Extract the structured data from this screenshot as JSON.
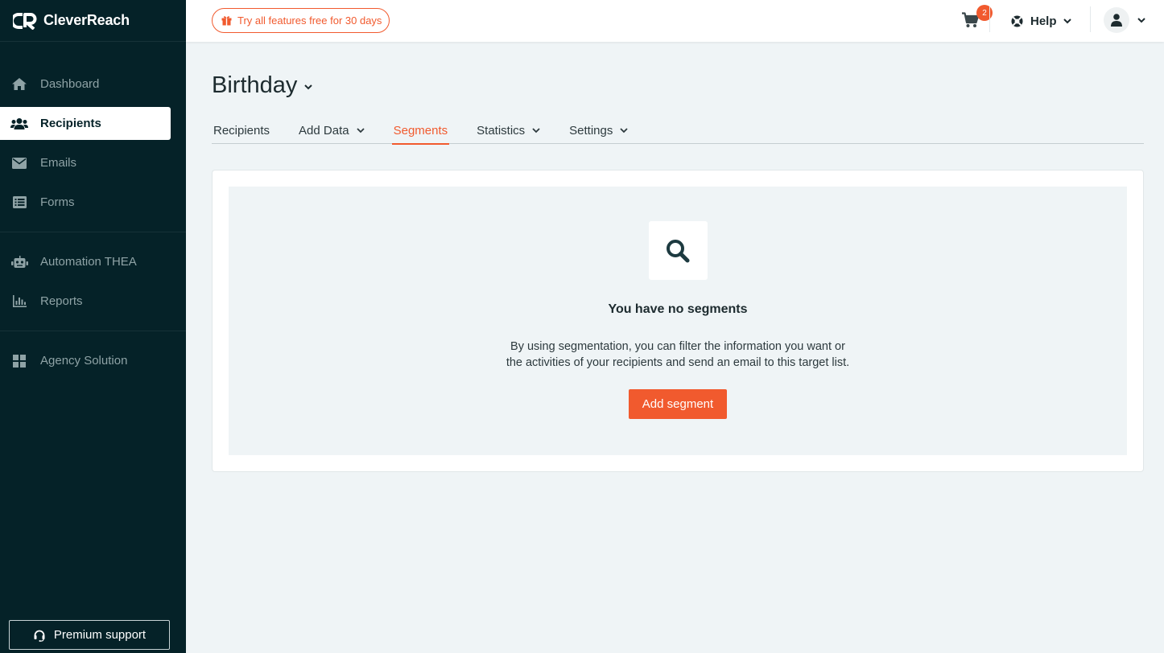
{
  "brand": {
    "name": "CleverReach",
    "accent": "#f15a2e",
    "sidebar_bg": "#052228"
  },
  "sidebar": {
    "items": [
      {
        "label": "Dashboard",
        "icon": "home-icon"
      },
      {
        "label": "Recipients",
        "icon": "users-icon",
        "active": true
      },
      {
        "label": "Emails",
        "icon": "envelope-icon"
      },
      {
        "label": "Forms",
        "icon": "list-icon"
      },
      {
        "label": "Automation THEA",
        "icon": "robot-icon"
      },
      {
        "label": "Reports",
        "icon": "bar-chart-icon"
      },
      {
        "label": "Agency Solution",
        "icon": "grid-icon"
      }
    ],
    "premium_support": "Premium support"
  },
  "topbar": {
    "trial_label": "Try all features free for 30 days",
    "cart_count": "2",
    "help_label": "Help"
  },
  "main": {
    "title": "Birthday",
    "tabs": [
      {
        "label": "Recipients"
      },
      {
        "label": "Add Data",
        "dropdown": true
      },
      {
        "label": "Segments",
        "active": true
      },
      {
        "label": "Statistics",
        "dropdown": true
      },
      {
        "label": "Settings",
        "dropdown": true
      }
    ],
    "empty_state": {
      "title": "You have no segments",
      "description_line1": "By using segmentation, you can filter the information you want or",
      "description_line2": "the activities of your recipients and send an email to this target list.",
      "button_label": "Add segment"
    }
  }
}
